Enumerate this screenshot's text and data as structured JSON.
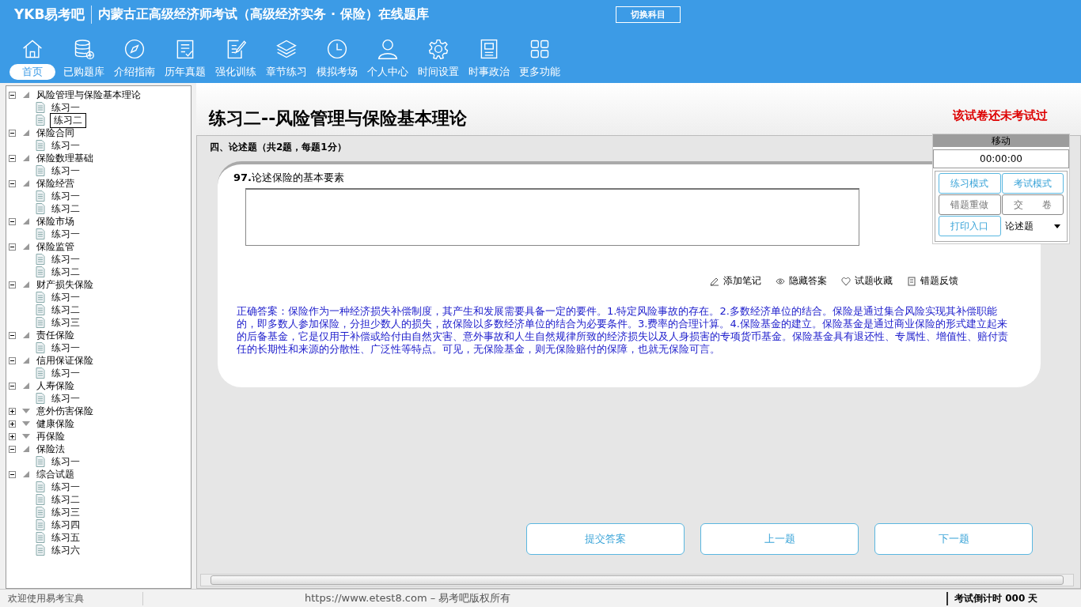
{
  "header": {
    "logo": "YKB易考吧",
    "title": "内蒙古正高级经济师考试（高级经济实务 · 保险）在线题库",
    "switch_button": "切换科目"
  },
  "nav": [
    {
      "label": "首页",
      "selected": true
    },
    {
      "label": "已购题库",
      "selected": false
    },
    {
      "label": "介绍指南",
      "selected": false
    },
    {
      "label": "历年真题",
      "selected": false
    },
    {
      "label": "强化训练",
      "selected": false
    },
    {
      "label": "章节练习",
      "selected": false
    },
    {
      "label": "模拟考场",
      "selected": false
    },
    {
      "label": "个人中心",
      "selected": false
    },
    {
      "label": "时间设置",
      "selected": false
    },
    {
      "label": "时事政治",
      "selected": false
    },
    {
      "label": "更多功能",
      "selected": false
    }
  ],
  "tree": [
    {
      "label": "风险管理与保险基本理论",
      "expanded": true,
      "children": [
        {
          "label": "练习一",
          "selected": false
        },
        {
          "label": "练习二",
          "selected": true
        }
      ]
    },
    {
      "label": "保险合同",
      "expanded": true,
      "children": [
        {
          "label": "练习一",
          "selected": false
        }
      ]
    },
    {
      "label": "保险数理基础",
      "expanded": true,
      "children": [
        {
          "label": "练习一",
          "selected": false
        }
      ]
    },
    {
      "label": "保险经营",
      "expanded": true,
      "children": [
        {
          "label": "练习一",
          "selected": false
        },
        {
          "label": "练习二",
          "selected": false
        }
      ]
    },
    {
      "label": "保险市场",
      "expanded": true,
      "children": [
        {
          "label": "练习一",
          "selected": false
        }
      ]
    },
    {
      "label": "保险监管",
      "expanded": true,
      "children": [
        {
          "label": "练习一",
          "selected": false
        },
        {
          "label": "练习二",
          "selected": false
        }
      ]
    },
    {
      "label": "财产损失保险",
      "expanded": true,
      "children": [
        {
          "label": "练习一",
          "selected": false
        },
        {
          "label": "练习二",
          "selected": false
        },
        {
          "label": "练习三",
          "selected": false
        }
      ]
    },
    {
      "label": "责任保险",
      "expanded": true,
      "children": [
        {
          "label": "练习一",
          "selected": false
        }
      ]
    },
    {
      "label": "信用保证保险",
      "expanded": true,
      "children": [
        {
          "label": "练习一",
          "selected": false
        }
      ]
    },
    {
      "label": "人寿保险",
      "expanded": true,
      "children": [
        {
          "label": "练习一",
          "selected": false
        }
      ]
    },
    {
      "label": "意外伤害保险",
      "expanded": false
    },
    {
      "label": "健康保险",
      "expanded": false
    },
    {
      "label": "再保险",
      "expanded": false
    },
    {
      "label": "保险法",
      "expanded": true,
      "children": [
        {
          "label": "练习一",
          "selected": false
        }
      ]
    },
    {
      "label": "综合试题",
      "expanded": true,
      "children": [
        {
          "label": "练习一",
          "selected": false
        },
        {
          "label": "练习二",
          "selected": false
        },
        {
          "label": "练习三",
          "selected": false
        },
        {
          "label": "练习四",
          "selected": false
        },
        {
          "label": "练习五",
          "selected": false
        },
        {
          "label": "练习六",
          "selected": false
        }
      ]
    }
  ],
  "exam": {
    "title": "练习二--风险管理与保险基本理论",
    "status": "该试卷还未考试过",
    "section": "四、论述题（共2题，每题1分）",
    "question_number": "97.",
    "question": "论述保险的基本要素",
    "tools": [
      "添加笔记",
      "隐藏答案",
      "试题收藏",
      "错题反馈"
    ],
    "answer": "正确答案：保险作为一种经济损失补偿制度，其产生和发展需要具备一定的要件。1.特定风险事故的存在。2.多数经济单位的结合。保险是通过集合风险实现其补偿职能的，即多数人参加保险，分担少数人的损失，故保险以多数经济单位的结合为必要条件。3.费率的合理计算。4.保险基金的建立。保险基金是通过商业保险的形式建立起来的后备基金，它是仅用于补偿或给付由自然灾害、意外事故和人生自然规律所致的经济损失以及人身损害的专项货币基金。保险基金具有退还性、专属性、增值性、赔付责任的长期性和来源的分散性、广泛性等特点。可见，无保险基金，则无保险赔付的保障，也就无保险可言。",
    "buttons": [
      "提交答案",
      "上一题",
      "下一题"
    ]
  },
  "panel": {
    "move": "移动",
    "timer": "00:00:00",
    "buttons": [
      {
        "label": "练习模式",
        "disabled": false
      },
      {
        "label": "考试模式",
        "disabled": false
      },
      {
        "label": "错题重做",
        "disabled": true
      },
      {
        "label": "交　　卷",
        "disabled": true
      },
      {
        "label": "打印入口",
        "disabled": false
      }
    ],
    "type_select": "论述题"
  },
  "status_bar": {
    "welcome": "欢迎使用易考宝典",
    "copyright": "https://www.etest8.com – 易考吧版权所有",
    "countdown": "考试倒计时 000 天"
  }
}
